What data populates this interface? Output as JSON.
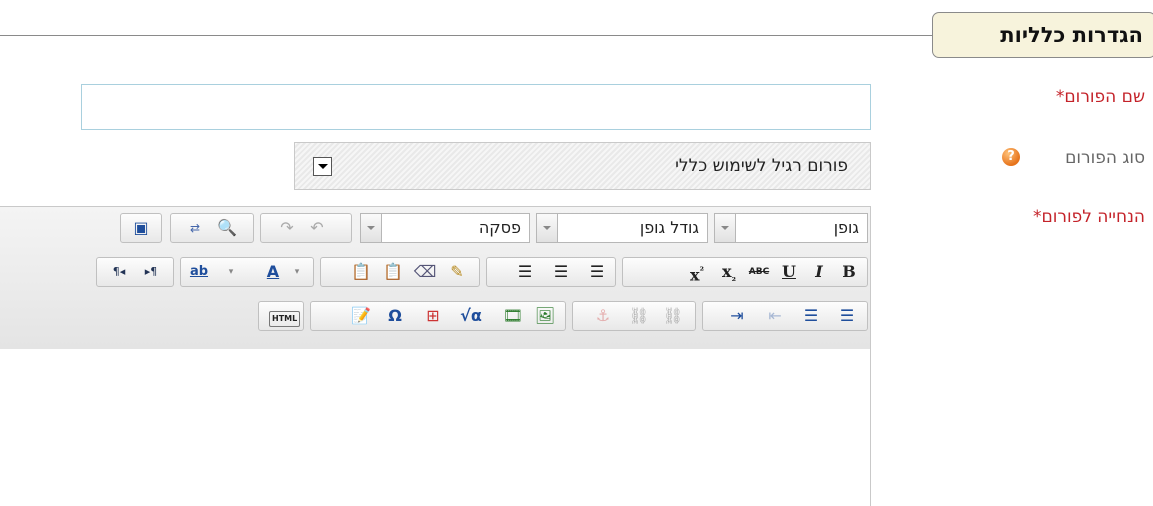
{
  "section": {
    "title": "הגדרות כלליות"
  },
  "fields": {
    "name_label": "שם הפורום",
    "type_label": "סוג הפורום",
    "instructions_label": "הנחייה לפורום",
    "required_mark": "*",
    "help_symbol": "?"
  },
  "forum_name": {
    "value": ""
  },
  "forum_type": {
    "selected": "פורום רגיל לשימוש כללי"
  },
  "editor": {
    "font_combo": "גופן",
    "size_combo": "גודל גופן",
    "format_combo": "פסקה",
    "buttons": {
      "bold": "B",
      "italic": "I",
      "underline": "U",
      "strike": "ABC",
      "subscript": "x",
      "superscript": "x",
      "source": "HTML",
      "special_char": "Ω",
      "font_color": "A",
      "highlight": "ab",
      "ltr": "▸¶",
      "rtl": "¶◂"
    }
  },
  "colors": {
    "required": "#c4232a",
    "legend_bg": "#f7f3dc",
    "input_border": "#a9d0de"
  }
}
